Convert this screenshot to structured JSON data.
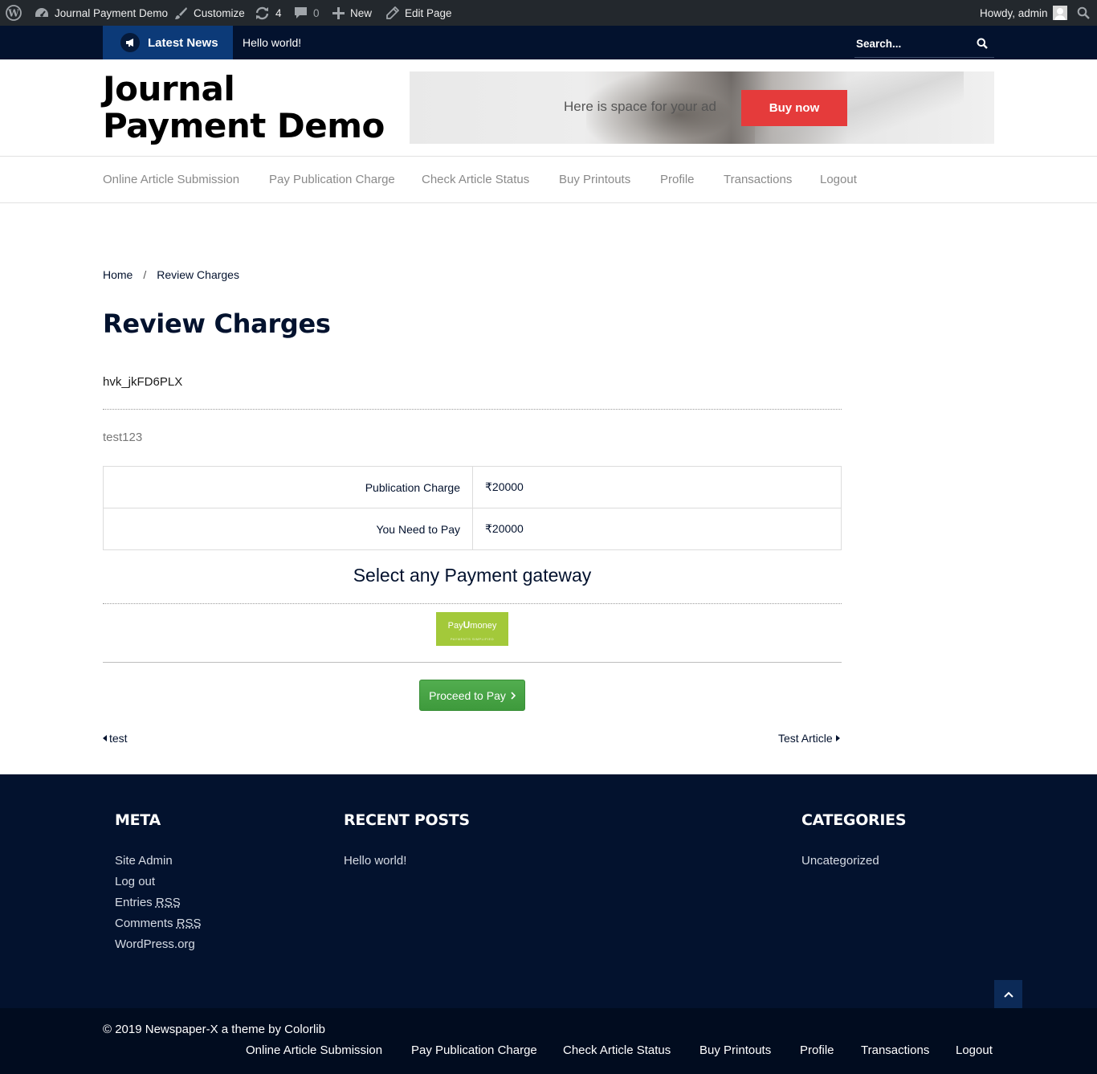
{
  "admin_bar": {
    "site_name": "Journal Payment Demo",
    "customize": "Customize",
    "updates_count": "4",
    "comments_count": "0",
    "new_label": "New",
    "edit_page": "Edit Page",
    "howdy": "Howdy, admin"
  },
  "top_bar": {
    "latest_news_label": "Latest News",
    "ticker_text": "Hello world!",
    "search_placeholder": "Search..."
  },
  "header": {
    "site_title": "Journal Payment Demo",
    "ad_text": "Here is space for your ad",
    "ad_button": "Buy now"
  },
  "main_nav": {
    "items": [
      "Online Article Submission",
      "Pay Publication Charge",
      "Check Article Status",
      "Buy Printouts",
      "Profile",
      "Transactions",
      "Logout"
    ]
  },
  "breadcrumb": {
    "home": "Home",
    "separator": "/",
    "current": "Review Charges"
  },
  "content": {
    "page_title": "Review Charges",
    "article_code": "hvk_jkFD6PLX",
    "article_title": "test123",
    "charges": [
      {
        "label": "Publication Charge",
        "value": "₹20000"
      },
      {
        "label": "You Need to Pay",
        "value": "₹20000"
      }
    ],
    "gateway_heading": "Select any Payment gateway",
    "gateway_logo": {
      "brand_left": "Pay",
      "brand_u": "U",
      "brand_right": "money",
      "tagline": "PAYMENTS SIMPLIFIED"
    },
    "proceed_button": "Proceed to Pay",
    "prev_post": "test",
    "next_post": "Test Article"
  },
  "footer": {
    "meta": {
      "title": "META",
      "site_admin": "Site Admin",
      "log_out": "Log out",
      "entries_prefix": "Entries ",
      "comments_prefix": "Comments ",
      "rss": "RSS",
      "wordpress": "WordPress.org"
    },
    "recent_posts": {
      "title": "RECENT POSTS",
      "items": [
        "Hello world!"
      ]
    },
    "categories": {
      "title": "CATEGORIES",
      "items": [
        "Uncategorized"
      ]
    },
    "copyright": "© 2019 Newspaper-X a theme by Colorlib",
    "nav": [
      "Online Article Submission",
      "Pay Publication Charge",
      "Check Article Status",
      "Buy Printouts",
      "Profile",
      "Transactions",
      "Logout"
    ]
  },
  "colors": {
    "navy": "#03122e",
    "accent_blue": "#0c3a78",
    "ad_red": "#e53b3b",
    "proceed_green": "#45a142",
    "payu_green": "#a3c93a"
  },
  "icons": [
    "wordpress-icon",
    "dashboard-icon",
    "brush-icon",
    "updates-icon",
    "comment-icon",
    "plus-icon",
    "pencil-icon",
    "search-icon",
    "megaphone-icon",
    "chevron-right-icon",
    "chevron-up-icon"
  ]
}
